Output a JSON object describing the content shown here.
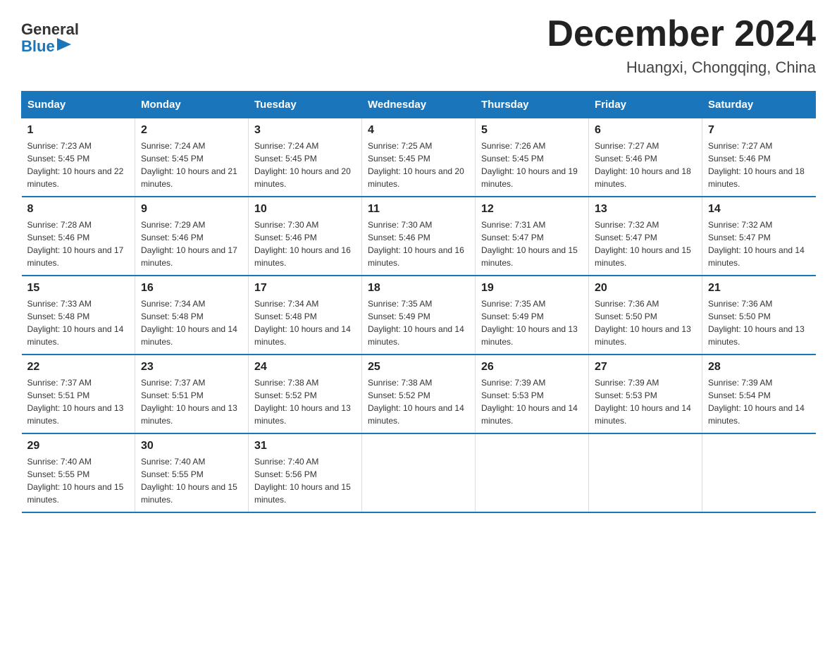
{
  "header": {
    "logo_general": "General",
    "logo_blue": "Blue",
    "title": "December 2024",
    "subtitle": "Huangxi, Chongqing, China"
  },
  "calendar": {
    "days_of_week": [
      "Sunday",
      "Monday",
      "Tuesday",
      "Wednesday",
      "Thursday",
      "Friday",
      "Saturday"
    ],
    "weeks": [
      [
        {
          "day": "1",
          "sunrise": "7:23 AM",
          "sunset": "5:45 PM",
          "daylight": "10 hours and 22 minutes."
        },
        {
          "day": "2",
          "sunrise": "7:24 AM",
          "sunset": "5:45 PM",
          "daylight": "10 hours and 21 minutes."
        },
        {
          "day": "3",
          "sunrise": "7:24 AM",
          "sunset": "5:45 PM",
          "daylight": "10 hours and 20 minutes."
        },
        {
          "day": "4",
          "sunrise": "7:25 AM",
          "sunset": "5:45 PM",
          "daylight": "10 hours and 20 minutes."
        },
        {
          "day": "5",
          "sunrise": "7:26 AM",
          "sunset": "5:45 PM",
          "daylight": "10 hours and 19 minutes."
        },
        {
          "day": "6",
          "sunrise": "7:27 AM",
          "sunset": "5:46 PM",
          "daylight": "10 hours and 18 minutes."
        },
        {
          "day": "7",
          "sunrise": "7:27 AM",
          "sunset": "5:46 PM",
          "daylight": "10 hours and 18 minutes."
        }
      ],
      [
        {
          "day": "8",
          "sunrise": "7:28 AM",
          "sunset": "5:46 PM",
          "daylight": "10 hours and 17 minutes."
        },
        {
          "day": "9",
          "sunrise": "7:29 AM",
          "sunset": "5:46 PM",
          "daylight": "10 hours and 17 minutes."
        },
        {
          "day": "10",
          "sunrise": "7:30 AM",
          "sunset": "5:46 PM",
          "daylight": "10 hours and 16 minutes."
        },
        {
          "day": "11",
          "sunrise": "7:30 AM",
          "sunset": "5:46 PM",
          "daylight": "10 hours and 16 minutes."
        },
        {
          "day": "12",
          "sunrise": "7:31 AM",
          "sunset": "5:47 PM",
          "daylight": "10 hours and 15 minutes."
        },
        {
          "day": "13",
          "sunrise": "7:32 AM",
          "sunset": "5:47 PM",
          "daylight": "10 hours and 15 minutes."
        },
        {
          "day": "14",
          "sunrise": "7:32 AM",
          "sunset": "5:47 PM",
          "daylight": "10 hours and 14 minutes."
        }
      ],
      [
        {
          "day": "15",
          "sunrise": "7:33 AM",
          "sunset": "5:48 PM",
          "daylight": "10 hours and 14 minutes."
        },
        {
          "day": "16",
          "sunrise": "7:34 AM",
          "sunset": "5:48 PM",
          "daylight": "10 hours and 14 minutes."
        },
        {
          "day": "17",
          "sunrise": "7:34 AM",
          "sunset": "5:48 PM",
          "daylight": "10 hours and 14 minutes."
        },
        {
          "day": "18",
          "sunrise": "7:35 AM",
          "sunset": "5:49 PM",
          "daylight": "10 hours and 14 minutes."
        },
        {
          "day": "19",
          "sunrise": "7:35 AM",
          "sunset": "5:49 PM",
          "daylight": "10 hours and 13 minutes."
        },
        {
          "day": "20",
          "sunrise": "7:36 AM",
          "sunset": "5:50 PM",
          "daylight": "10 hours and 13 minutes."
        },
        {
          "day": "21",
          "sunrise": "7:36 AM",
          "sunset": "5:50 PM",
          "daylight": "10 hours and 13 minutes."
        }
      ],
      [
        {
          "day": "22",
          "sunrise": "7:37 AM",
          "sunset": "5:51 PM",
          "daylight": "10 hours and 13 minutes."
        },
        {
          "day": "23",
          "sunrise": "7:37 AM",
          "sunset": "5:51 PM",
          "daylight": "10 hours and 13 minutes."
        },
        {
          "day": "24",
          "sunrise": "7:38 AM",
          "sunset": "5:52 PM",
          "daylight": "10 hours and 13 minutes."
        },
        {
          "day": "25",
          "sunrise": "7:38 AM",
          "sunset": "5:52 PM",
          "daylight": "10 hours and 14 minutes."
        },
        {
          "day": "26",
          "sunrise": "7:39 AM",
          "sunset": "5:53 PM",
          "daylight": "10 hours and 14 minutes."
        },
        {
          "day": "27",
          "sunrise": "7:39 AM",
          "sunset": "5:53 PM",
          "daylight": "10 hours and 14 minutes."
        },
        {
          "day": "28",
          "sunrise": "7:39 AM",
          "sunset": "5:54 PM",
          "daylight": "10 hours and 14 minutes."
        }
      ],
      [
        {
          "day": "29",
          "sunrise": "7:40 AM",
          "sunset": "5:55 PM",
          "daylight": "10 hours and 15 minutes."
        },
        {
          "day": "30",
          "sunrise": "7:40 AM",
          "sunset": "5:55 PM",
          "daylight": "10 hours and 15 minutes."
        },
        {
          "day": "31",
          "sunrise": "7:40 AM",
          "sunset": "5:56 PM",
          "daylight": "10 hours and 15 minutes."
        },
        null,
        null,
        null,
        null
      ]
    ]
  }
}
